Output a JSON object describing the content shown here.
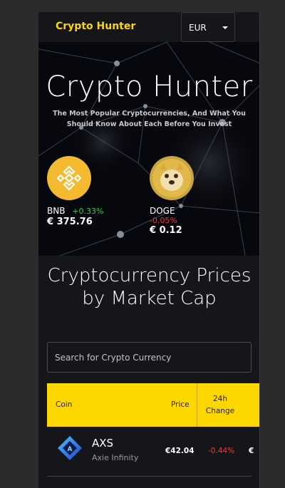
{
  "header": {
    "brand": "Crypto Hunter",
    "currency_selected": "EUR"
  },
  "banner": {
    "title": "Crypto Hunter",
    "subtitle": "The Most Popular Cryptocurrencies, And What You Should Know About Each Before You Invest",
    "carousel": [
      {
        "symbol": "BNB",
        "change": "+0.33%",
        "change_direction": "up",
        "price": "€ 375.76",
        "icon": "bnb-icon"
      },
      {
        "symbol": "DOGE",
        "change": "-0.05%",
        "change_direction": "down",
        "price": "€ 0.12",
        "icon": "doge-icon"
      }
    ]
  },
  "main": {
    "section_title": "Cryptocurrency Prices by Market Cap",
    "search_placeholder": "Search for Crypto Currency",
    "table": {
      "columns": [
        "Coin",
        "Price",
        "24h Change"
      ],
      "rows": [
        {
          "symbol": "AXS",
          "name": "Axie Infinity",
          "price": "€42.04",
          "change": "-0.44%",
          "market_cap": "€",
          "icon": "axs-icon"
        }
      ]
    }
  },
  "colors": {
    "accent": "#ffd700",
    "up": "#2ecc40",
    "down": "#ff3333",
    "background": "#14161a"
  }
}
